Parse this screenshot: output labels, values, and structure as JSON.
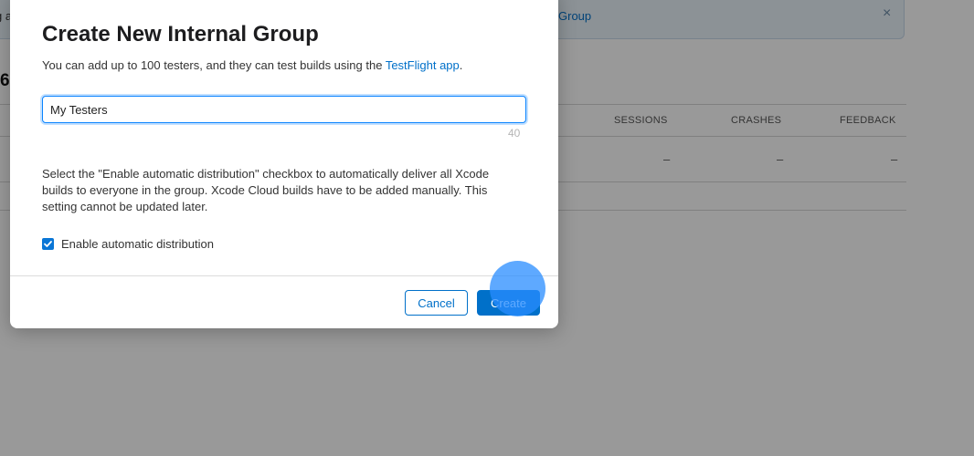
{
  "background": {
    "banner": {
      "left_text": "g a",
      "link_text": "Group",
      "close_glyph": "×"
    },
    "heading_fragment": "6",
    "table": {
      "columns": [
        "SESSIONS",
        "CRASHES",
        "FEEDBACK"
      ],
      "rows": [
        [
          "–",
          "–",
          "–"
        ]
      ]
    }
  },
  "modal": {
    "title": "Create New Internal Group",
    "subtitle_prefix": "You can add up to 100 testers, and they can test builds using the ",
    "subtitle_link": "TestFlight app",
    "subtitle_suffix": ".",
    "name_input": {
      "value": "My Testers",
      "remaining_chars": "40"
    },
    "description": "Select the \"Enable automatic distribution\" checkbox to automatically deliver all Xcode builds to everyone in the group. Xcode Cloud builds have to be added manually. This setting cannot be updated later.",
    "checkbox": {
      "label": "Enable automatic distribution",
      "checked": true
    },
    "buttons": {
      "cancel": "Cancel",
      "create": "Create"
    }
  },
  "colors": {
    "accent": "#0070c9",
    "checkbox": "#0a76d6",
    "overlay": "rgba(0,0,0,0.4)"
  },
  "icons": {
    "banner_close": "close-icon",
    "checkbox_mark": "checkmark-icon"
  }
}
